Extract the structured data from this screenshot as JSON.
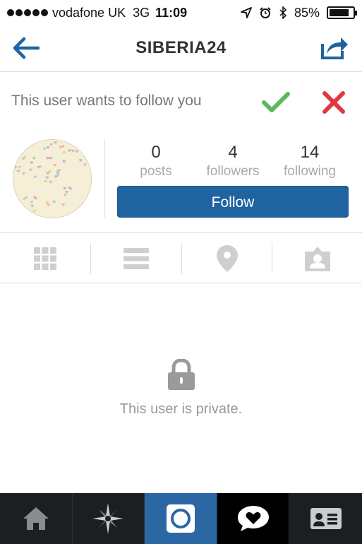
{
  "status_bar": {
    "carrier": "vodafone UK",
    "network": "3G",
    "time": "11:09",
    "battery_percent": "85%",
    "battery_level": 0.85,
    "icons": [
      "signal-dots-icon",
      "location-arrow-icon",
      "alarm-clock-icon",
      "bluetooth-icon",
      "battery-icon"
    ]
  },
  "nav": {
    "title": "SIBERIA24",
    "back_icon": "back-arrow-icon",
    "share_icon": "share-icon"
  },
  "follow_request": {
    "text": "This user wants to follow you",
    "approve_icon": "checkmark-icon",
    "deny_icon": "x-icon"
  },
  "profile": {
    "stats": [
      {
        "value": "0",
        "label": "posts"
      },
      {
        "value": "4",
        "label": "followers"
      },
      {
        "value": "14",
        "label": "following"
      }
    ],
    "follow_label": "Follow"
  },
  "view_tabs": [
    "grid-icon",
    "list-icon",
    "location-pin-icon",
    "tagged-person-icon"
  ],
  "private": {
    "text": "This user is private."
  },
  "tab_bar": [
    "home-icon",
    "explore-star-icon",
    "camera-icon",
    "news-heart-bubble-icon",
    "profile-card-icon"
  ],
  "colors": {
    "accent_blue": "#1f64a0",
    "approve_green": "#5cb85c",
    "deny_red": "#e0393e",
    "tab_bar_bg": "#1c1f21"
  }
}
